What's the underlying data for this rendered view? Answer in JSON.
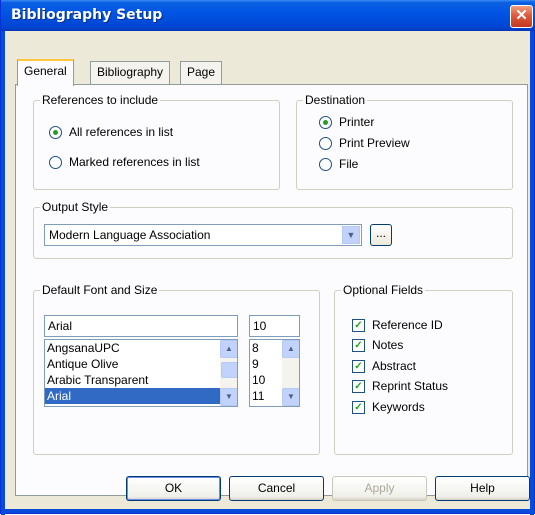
{
  "window": {
    "title": "Bibliography Setup",
    "close_glyph": "✕"
  },
  "tabs": [
    {
      "label": "General",
      "active": true
    },
    {
      "label": "Bibliography",
      "active": false
    },
    {
      "label": "Page",
      "active": false
    }
  ],
  "references": {
    "legend": "References to include",
    "options": [
      {
        "label": "All references in list",
        "selected": true
      },
      {
        "label": "Marked references in list",
        "selected": false
      }
    ]
  },
  "destination": {
    "legend": "Destination",
    "options": [
      {
        "label": "Printer",
        "selected": true
      },
      {
        "label": "Print Preview",
        "selected": false
      },
      {
        "label": "File",
        "selected": false
      }
    ]
  },
  "output_style": {
    "legend": "Output Style",
    "value": "Modern Language Association",
    "browse_label": "..."
  },
  "font": {
    "legend": "Default Font and Size",
    "font_value": "Arial",
    "size_value": "10",
    "font_list": [
      "AngsanaUPC",
      "Antique Olive",
      "Arabic Transparent",
      "Arial"
    ],
    "size_list": [
      "8",
      "9",
      "10",
      "11"
    ]
  },
  "optional_fields": {
    "legend": "Optional Fields",
    "items": [
      {
        "label": "Reference ID",
        "checked": true
      },
      {
        "label": "Notes",
        "checked": true
      },
      {
        "label": "Abstract",
        "checked": true
      },
      {
        "label": "Reprint Status",
        "checked": true
      },
      {
        "label": "Keywords",
        "checked": true
      }
    ]
  },
  "buttons": {
    "ok": "OK",
    "cancel": "Cancel",
    "apply": "Apply",
    "help": "Help"
  },
  "colors": {
    "title_bar": "#0055e5",
    "selection": "#316ac5",
    "dialog_bg": "#ece9d8"
  }
}
